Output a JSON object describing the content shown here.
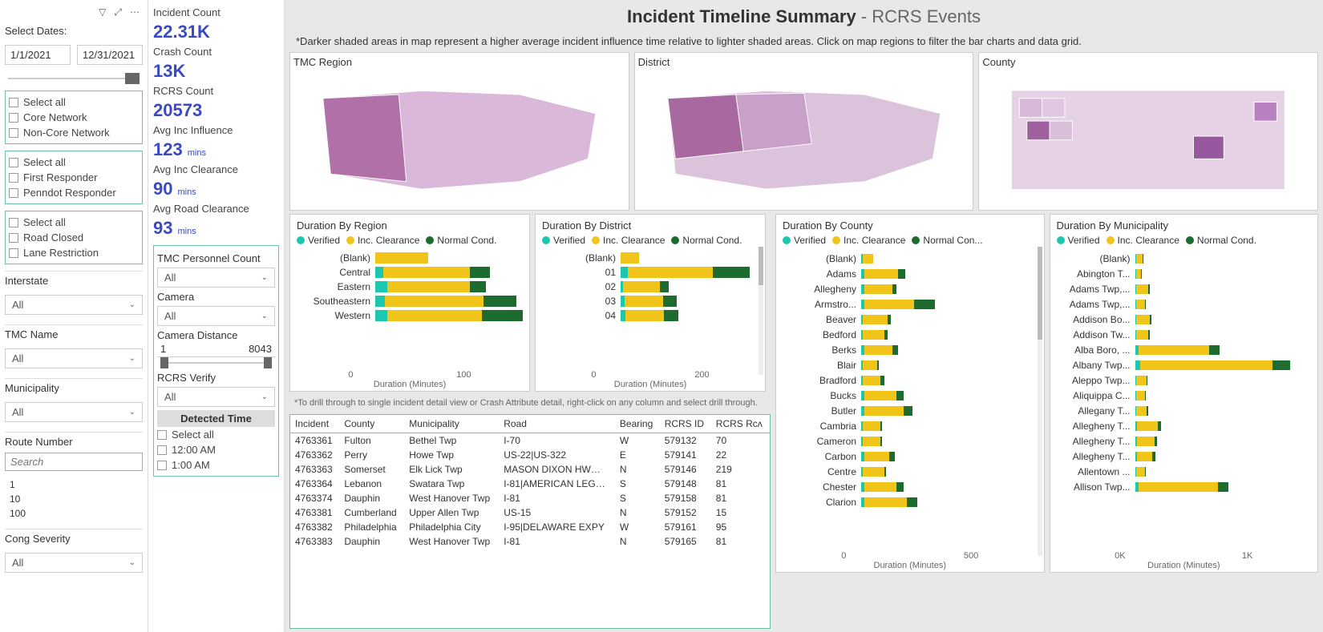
{
  "title": {
    "main": "Incident Timeline Summary",
    "sub": " - RCRS Events"
  },
  "note_map": "*Darker shaded areas in map represent a higher average incident influence time relative to lighter shaded areas. Click on map regions to filter the bar charts and data grid.",
  "note_table": "*To drill through to single incident detail view or Crash Attribute detail, right-click on any column and select drill through.",
  "dates": {
    "label": "Select Dates:",
    "from": "1/1/2021",
    "to": "12/31/2021"
  },
  "slicer_network": {
    "items": [
      "Select all",
      "Core Network",
      "Non-Core Network"
    ]
  },
  "slicer_responder": {
    "items": [
      "Select all",
      "First Responder",
      "Penndot Responder"
    ]
  },
  "slicer_road": {
    "items": [
      "Select all",
      "Road Closed",
      "Lane Restriction"
    ]
  },
  "dropdowns": {
    "interstate": {
      "label": "Interstate",
      "value": "All"
    },
    "tmc": {
      "label": "TMC Name",
      "value": "All"
    },
    "municipality": {
      "label": "Municipality",
      "value": "All"
    },
    "cong": {
      "label": "Cong Severity",
      "value": "All"
    }
  },
  "route": {
    "label": "Route Number",
    "placeholder": "Search",
    "options": [
      "1",
      "10",
      "100"
    ]
  },
  "kpi": {
    "incident_label": "Incident Count",
    "incident_value": "22.31K",
    "crash_label": "Crash Count",
    "crash_value": "13K",
    "rcrs_label": "RCRS Count",
    "rcrs_value": "20573",
    "influence_label": "Avg Inc Influence",
    "influence_value": "123",
    "influence_unit": "mins",
    "clear_label": "Avg Inc Clearance",
    "clear_value": "90",
    "clear_unit": "mins",
    "road_label": "Avg Road Clearance",
    "road_value": "93",
    "road_unit": "mins"
  },
  "mid": {
    "personnel_label": "TMC Personnel Count",
    "personnel_value": "All",
    "camera_label": "Camera",
    "camera_value": "All",
    "cam_dist_label": "Camera Distance",
    "cam_dist_min": "1",
    "cam_dist_max": "8043",
    "verify_label": "RCRS Verify",
    "verify_value": "All",
    "det_time_label": "Detected Time",
    "det_time_items": [
      "Select all",
      "12:00 AM",
      "1:00 AM"
    ]
  },
  "maps": {
    "tmc": "TMC Region",
    "district": "District",
    "county": "County"
  },
  "legend": {
    "ver": "Verified",
    "inc": "Inc. Clearance",
    "nor": "Normal Cond.",
    "nor_trunc": "Normal Con..."
  },
  "chart_region": {
    "title": "Duration By Region",
    "axis_label": "Duration (Minutes)",
    "ticks": [
      "0",
      "100"
    ]
  },
  "chart_district": {
    "title": "Duration By District",
    "axis_label": "Duration (Minutes)",
    "ticks": [
      "0",
      "200"
    ]
  },
  "chart_county": {
    "title": "Duration By County",
    "axis_label": "Duration (Minutes)",
    "ticks": [
      "0",
      "500"
    ]
  },
  "chart_muni": {
    "title": "Duration By Municipality",
    "axis_label": "Duration (Minutes)",
    "ticks": [
      "0K",
      "1K"
    ]
  },
  "table": {
    "headers": [
      "Incident",
      "County",
      "Municipality",
      "Road",
      "Bearing",
      "RCRS ID",
      "RCRS Rcʌ"
    ],
    "rows": [
      [
        "4763361",
        "Fulton",
        "Bethel Twp",
        "I-70",
        "W",
        "579132",
        "70"
      ],
      [
        "4763362",
        "Perry",
        "Howe Twp",
        "US-22|US-322",
        "E",
        "579141",
        "22"
      ],
      [
        "4763363",
        "Somerset",
        "Elk Lick Twp",
        "MASON DIXON HW…",
        "N",
        "579146",
        "219"
      ],
      [
        "4763364",
        "Lebanon",
        "Swatara Twp",
        "I-81|AMERICAN LEG…",
        "S",
        "579148",
        "81"
      ],
      [
        "4763374",
        "Dauphin",
        "West Hanover Twp",
        "I-81",
        "S",
        "579158",
        "81"
      ],
      [
        "4763381",
        "Cumberland",
        "Upper Allen Twp",
        "US-15",
        "N",
        "579152",
        "15"
      ],
      [
        "4763382",
        "Philadelphia",
        "Philadelphia City",
        "I-95|DELAWARE EXPY",
        "W",
        "579161",
        "95"
      ],
      [
        "4763383",
        "Dauphin",
        "West Hanover Twp",
        "I-81",
        "N",
        "579165",
        "81"
      ]
    ]
  },
  "chart_data": [
    {
      "type": "bar",
      "id": "region",
      "title": "Duration By Region",
      "xlabel": "Duration (Minutes)",
      "categories": [
        "(Blank)",
        "Central",
        "Eastern",
        "Southeastern",
        "Western"
      ],
      "series": [
        {
          "name": "Verified",
          "values": [
            0,
            10,
            15,
            12,
            15
          ]
        },
        {
          "name": "Inc. Clearance",
          "values": [
            65,
            105,
            100,
            120,
            115
          ]
        },
        {
          "name": "Normal Cond.",
          "values": [
            0,
            25,
            20,
            40,
            50
          ]
        }
      ],
      "xlim": [
        0,
        180
      ]
    },
    {
      "type": "bar",
      "id": "district",
      "title": "Duration By District",
      "xlabel": "Duration (Minutes)",
      "categories": [
        "(Blank)",
        "01",
        "02",
        "03",
        "04"
      ],
      "series": [
        {
          "name": "Verified",
          "values": [
            0,
            15,
            5,
            8,
            10
          ]
        },
        {
          "name": "Inc. Clearance",
          "values": [
            40,
            185,
            80,
            85,
            85
          ]
        },
        {
          "name": "Normal Cond.",
          "values": [
            0,
            80,
            20,
            30,
            30
          ]
        }
      ],
      "xlim": [
        0,
        300
      ]
    },
    {
      "type": "bar",
      "id": "county",
      "title": "Duration By County",
      "xlabel": "Duration (Minutes)",
      "categories": [
        "(Blank)",
        "Adams",
        "Allegheny",
        "Armstro...",
        "Beaver",
        "Bedford",
        "Berks",
        "Blair",
        "Bradford",
        "Bucks",
        "Butler",
        "Cambria",
        "Cameron",
        "Carbon",
        "Centre",
        "Chester",
        "Clarion"
      ],
      "series": [
        {
          "name": "Verified",
          "values": [
            5,
            10,
            10,
            10,
            5,
            5,
            10,
            5,
            5,
            10,
            10,
            5,
            5,
            10,
            5,
            10,
            10
          ]
        },
        {
          "name": "Inc. Clearance",
          "values": [
            30,
            95,
            80,
            140,
            70,
            60,
            80,
            40,
            50,
            90,
            110,
            50,
            50,
            70,
            60,
            90,
            120
          ]
        },
        {
          "name": "Normal Cond.",
          "values": [
            0,
            20,
            10,
            60,
            10,
            10,
            15,
            5,
            10,
            20,
            25,
            5,
            5,
            15,
            5,
            20,
            30
          ]
        }
      ],
      "xlim": [
        0,
        500
      ]
    },
    {
      "type": "bar",
      "id": "municipality",
      "title": "Duration By Municipality",
      "xlabel": "Duration (Minutes)",
      "categories": [
        "(Blank)",
        "Abington T...",
        "Adams Twp,...",
        "Adams Twp,...",
        "Addison Bo...",
        "Addison Tw...",
        "Alba Boro, ...",
        "Albany Twp...",
        "Aleppo Twp...",
        "Aliquippa C...",
        "Allegany T...",
        "Allegheny T...",
        "Allegheny T...",
        "Allegheny T...",
        "Allentown ...",
        "Allison Twp..."
      ],
      "series": [
        {
          "name": "Verified",
          "values": [
            5,
            5,
            5,
            5,
            5,
            5,
            20,
            30,
            5,
            5,
            5,
            10,
            10,
            10,
            5,
            20
          ]
        },
        {
          "name": "Inc. Clearance",
          "values": [
            40,
            30,
            70,
            50,
            80,
            70,
            400,
            750,
            60,
            50,
            60,
            120,
            100,
            90,
            50,
            450
          ]
        },
        {
          "name": "Normal Cond.",
          "values": [
            5,
            5,
            10,
            5,
            10,
            10,
            60,
            100,
            5,
            5,
            10,
            20,
            15,
            15,
            5,
            60
          ]
        }
      ],
      "xlim": [
        0,
        1000
      ]
    }
  ]
}
